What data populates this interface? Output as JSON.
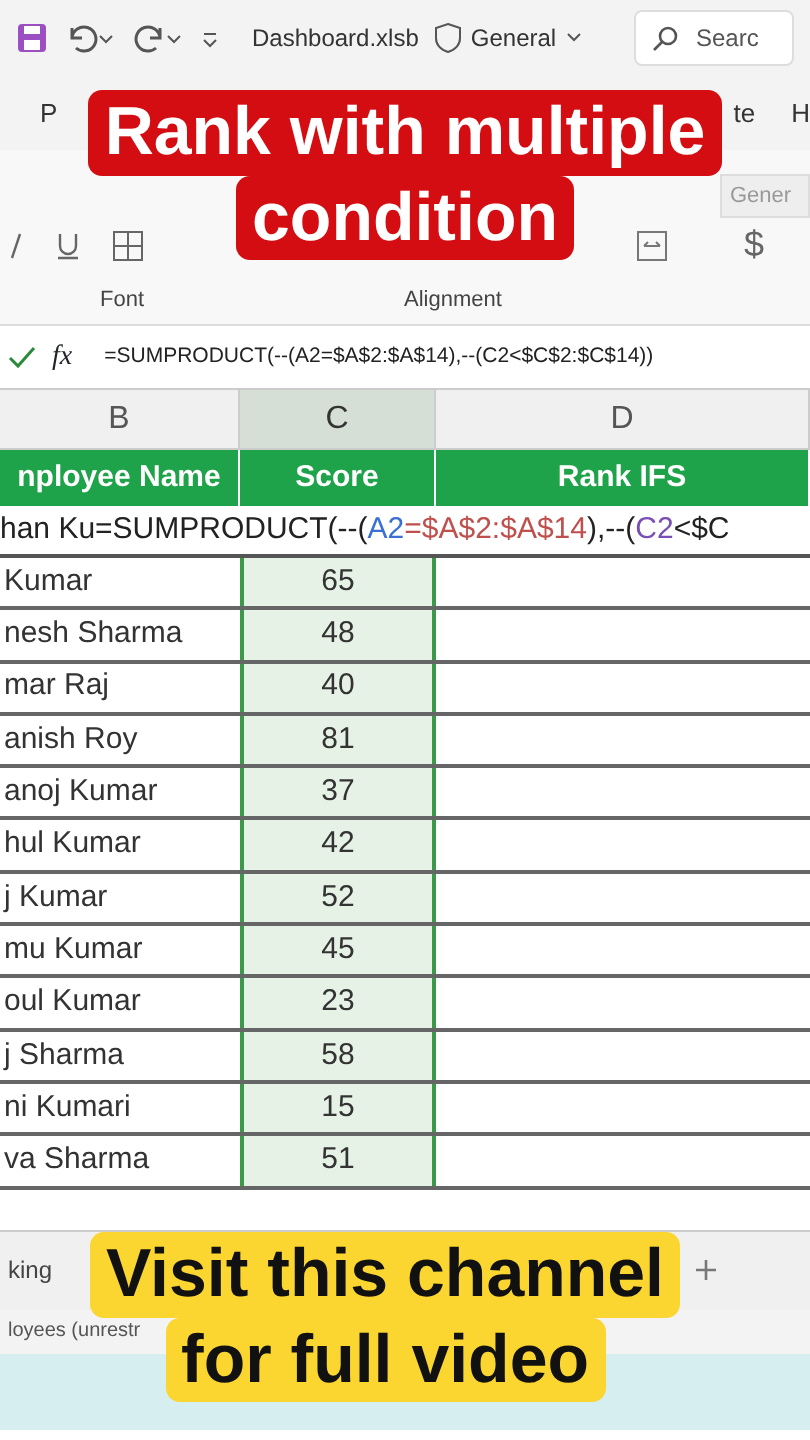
{
  "title_bar": {
    "file_name": "Dashboard.xlsb",
    "sensitivity": "General",
    "search_placeholder": "Searc"
  },
  "ribbon_tabs": [
    {
      "label": "P"
    },
    {
      "label": "te"
    },
    {
      "label": "H"
    }
  ],
  "ribbon_groups": [
    {
      "label": "Font"
    },
    {
      "label": "Alignment"
    }
  ],
  "number_format": {
    "value": "Gener"
  },
  "currency_symbol": "$",
  "formula_bar": {
    "function_label": "fx",
    "formula": "=SUMPRODUCT(--(A2=$A$2:$A$14),--(C2<$C$2:$C$14))"
  },
  "sheet": {
    "column_letters": [
      "B",
      "C",
      "D"
    ],
    "header": [
      "nployee Name",
      "Score",
      "Rank IFS"
    ],
    "editing_cell": {
      "segments": [
        {
          "text": "han Ku=SUMPRODUCT(--(",
          "color": "#222222"
        },
        {
          "text": "A2",
          "color": "#3b6fd4"
        },
        {
          "text": "=$A$2:$A$14",
          "color": "#c0504d"
        },
        {
          "text": "),--(",
          "color": "#222222"
        },
        {
          "text": "C2",
          "color": "#7a4fb5"
        },
        {
          "text": "<$C",
          "color": "#222222"
        }
      ]
    },
    "rows": [
      {
        "name": "Kumar",
        "score": "65"
      },
      {
        "name": "nesh Sharma",
        "score": "48"
      },
      {
        "name": "mar Raj",
        "score": "40"
      },
      {
        "name": "anish Roy",
        "score": "81"
      },
      {
        "name": "anoj Kumar",
        "score": "37"
      },
      {
        "name": "hul Kumar",
        "score": "42"
      },
      {
        "name": "j Kumar",
        "score": "52"
      },
      {
        "name": "mu Kumar",
        "score": "45"
      },
      {
        "name": "oul Kumar",
        "score": "23"
      },
      {
        "name": "j Sharma",
        "score": "58"
      },
      {
        "name": "ni Kumari",
        "score": "15"
      },
      {
        "name": "va Sharma",
        "score": "51"
      }
    ]
  },
  "sheet_tabs": [
    {
      "label": "king"
    }
  ],
  "status_bar": {
    "text": "loyees (unrestr"
  },
  "captions": [
    {
      "kind": "top",
      "lines": [
        "Rank with multiple",
        "condition"
      ]
    },
    {
      "kind": "bottom",
      "lines": [
        "Visit this channel",
        "for full video"
      ]
    }
  ]
}
